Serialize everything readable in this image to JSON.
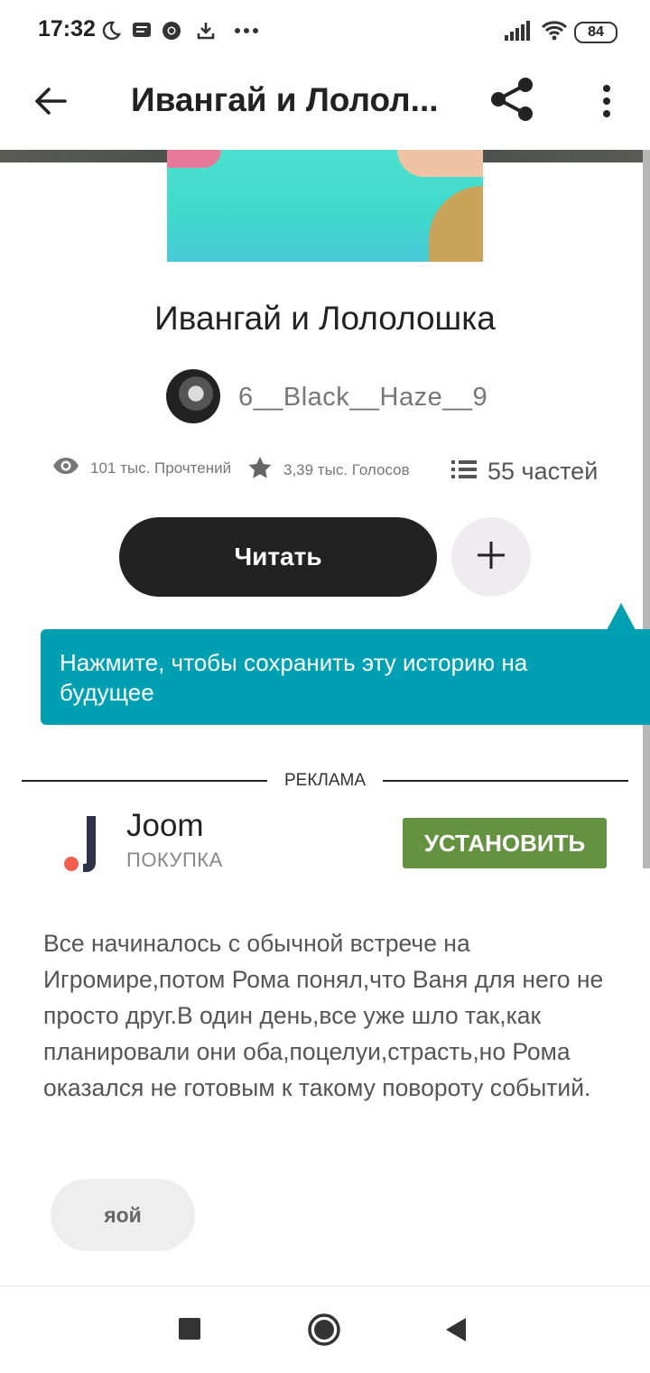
{
  "status_bar": {
    "time": "17:32",
    "icons": [
      "moon-icon",
      "message-icon",
      "chrome-icon",
      "download-icon",
      "more-dots-icon",
      "signal-icon",
      "wifi-icon"
    ],
    "battery": "84"
  },
  "app_bar": {
    "title": "Ивангай и Лолол...",
    "icons": [
      "back-arrow-icon",
      "share-icon",
      "more-vert-icon"
    ]
  },
  "story": {
    "title": "Ивангай и Лололошка",
    "author": "6__Black__Haze__9",
    "reads": "101 тыс. Прочтений",
    "votes": "3,39 тыс. Голосов",
    "parts": "55 частей",
    "read_button": "Читать",
    "add_icon": "plus-icon"
  },
  "tooltip": {
    "text": "Нажмите, чтобы сохранить эту историю на будущее"
  },
  "ad": {
    "label": "РЕКЛАМА",
    "app_name": "Joom",
    "category": "ПОКУПКА",
    "install_button": "УСТАНОВИТЬ"
  },
  "description": "Все начиналось с обычной встрече на Игромире,потом Рома понял,что Ваня для него не просто друг.В один день,все уже шло так,как планировали они оба,поцелуи,страсть,но Рома оказался не готовым к такому повороту событий.",
  "tag": "яой",
  "nav_bar": {
    "icons": [
      "recents-square-icon",
      "home-circle-icon",
      "back-triangle-icon"
    ]
  },
  "colors": {
    "tooltip": "#00a0b3",
    "install_button": "#659240",
    "read_button": "#222222"
  }
}
